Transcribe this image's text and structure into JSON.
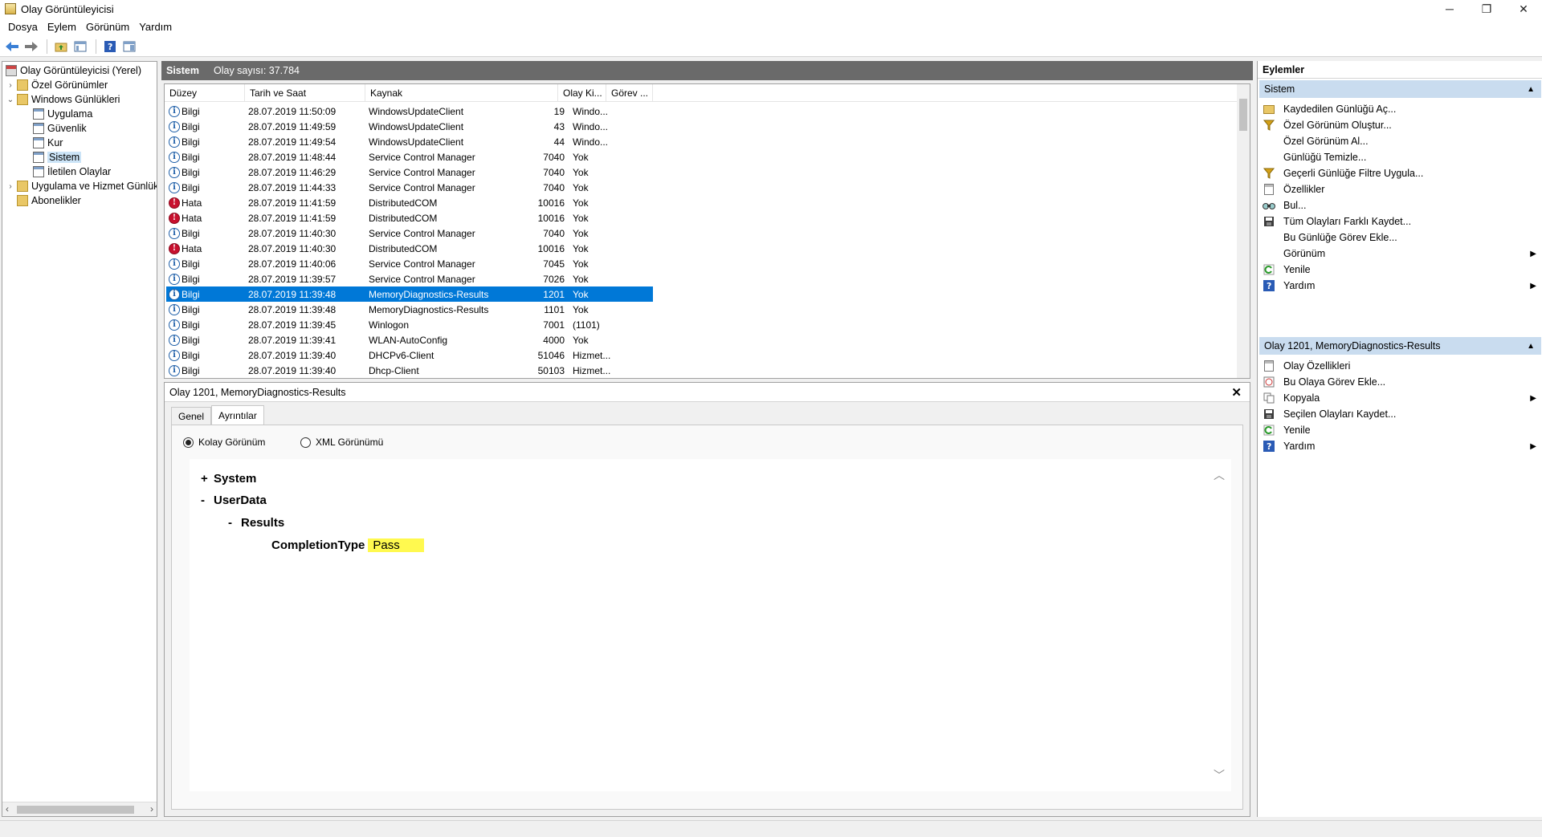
{
  "window": {
    "title": "Olay Görüntüleyicisi",
    "min": "─",
    "max": "❐",
    "close": "✕"
  },
  "menu": [
    "Dosya",
    "Eylem",
    "Görünüm",
    "Yardım"
  ],
  "tree": [
    {
      "label": "Olay Görüntüleyicisi (Yerel)",
      "icon": "event-viewer-icon"
    },
    {
      "label": "Özel Görünümler",
      "icon": "folder-icon"
    },
    {
      "label": "Windows Günlükleri",
      "icon": "folder-icon"
    },
    {
      "label": "Uygulama",
      "icon": "log-icon"
    },
    {
      "label": "Güvenlik",
      "icon": "log-icon"
    },
    {
      "label": "Kur",
      "icon": "log-icon"
    },
    {
      "label": "Sistem",
      "icon": "log-icon"
    },
    {
      "label": "İletilen Olaylar",
      "icon": "log-icon"
    },
    {
      "label": "Uygulama ve Hizmet Günlük",
      "icon": "folder-icon"
    },
    {
      "label": "Abonelikler",
      "icon": "folder-icon"
    }
  ],
  "center": {
    "title": "Sistem",
    "count_label": "Olay sayısı: 37.784",
    "columns": [
      "Düzey",
      "Tarih ve Saat",
      "Kaynak",
      "Olay Ki...",
      "Görev ..."
    ],
    "rows": [
      {
        "level": "Bilgi",
        "date": "28.07.2019 11:50:09",
        "source": "WindowsUpdateClient",
        "id": "19",
        "task": "Windo..."
      },
      {
        "level": "Bilgi",
        "date": "28.07.2019 11:49:59",
        "source": "WindowsUpdateClient",
        "id": "43",
        "task": "Windo..."
      },
      {
        "level": "Bilgi",
        "date": "28.07.2019 11:49:54",
        "source": "WindowsUpdateClient",
        "id": "44",
        "task": "Windo..."
      },
      {
        "level": "Bilgi",
        "date": "28.07.2019 11:48:44",
        "source": "Service Control Manager",
        "id": "7040",
        "task": "Yok"
      },
      {
        "level": "Bilgi",
        "date": "28.07.2019 11:46:29",
        "source": "Service Control Manager",
        "id": "7040",
        "task": "Yok"
      },
      {
        "level": "Bilgi",
        "date": "28.07.2019 11:44:33",
        "source": "Service Control Manager",
        "id": "7040",
        "task": "Yok"
      },
      {
        "level": "Hata",
        "date": "28.07.2019 11:41:59",
        "source": "DistributedCOM",
        "id": "10016",
        "task": "Yok"
      },
      {
        "level": "Hata",
        "date": "28.07.2019 11:41:59",
        "source": "DistributedCOM",
        "id": "10016",
        "task": "Yok"
      },
      {
        "level": "Bilgi",
        "date": "28.07.2019 11:40:30",
        "source": "Service Control Manager",
        "id": "7040",
        "task": "Yok"
      },
      {
        "level": "Hata",
        "date": "28.07.2019 11:40:30",
        "source": "DistributedCOM",
        "id": "10016",
        "task": "Yok"
      },
      {
        "level": "Bilgi",
        "date": "28.07.2019 11:40:06",
        "source": "Service Control Manager",
        "id": "7045",
        "task": "Yok"
      },
      {
        "level": "Bilgi",
        "date": "28.07.2019 11:39:57",
        "source": "Service Control Manager",
        "id": "7026",
        "task": "Yok"
      },
      {
        "level": "Bilgi",
        "date": "28.07.2019 11:39:48",
        "source": "MemoryDiagnostics-Results",
        "id": "1201",
        "task": "Yok"
      },
      {
        "level": "Bilgi",
        "date": "28.07.2019 11:39:48",
        "source": "MemoryDiagnostics-Results",
        "id": "1101",
        "task": "Yok"
      },
      {
        "level": "Bilgi",
        "date": "28.07.2019 11:39:45",
        "source": "Winlogon",
        "id": "7001",
        "task": "(1101)"
      },
      {
        "level": "Bilgi",
        "date": "28.07.2019 11:39:41",
        "source": "WLAN-AutoConfig",
        "id": "4000",
        "task": "Yok"
      },
      {
        "level": "Bilgi",
        "date": "28.07.2019 11:39:40",
        "source": "DHCPv6-Client",
        "id": "51046",
        "task": "Hizmet..."
      },
      {
        "level": "Bilgi",
        "date": "28.07.2019 11:39:40",
        "source": "Dhcp-Client",
        "id": "50103",
        "task": "Hizmet..."
      }
    ]
  },
  "detail": {
    "title": "Olay 1201, MemoryDiagnostics-Results",
    "tabs": [
      "Genel",
      "Ayrıntılar"
    ],
    "radio_friendly": "Kolay Görünüm",
    "radio_xml": "XML Görünümü",
    "xml": {
      "system_sign": "+",
      "system": "System",
      "userdata_sign": "-",
      "userdata": "UserData",
      "results_sign": "-",
      "results": "Results",
      "completion_key": "CompletionType",
      "completion_value": "Pass"
    }
  },
  "actions": {
    "title": "Eylemler",
    "section1": "Sistem",
    "items1": [
      {
        "label": "Kaydedilen Günlüğü Aç...",
        "icon": "open-folder-icon"
      },
      {
        "label": "Özel Görünüm Oluştur...",
        "icon": "filter-icon"
      },
      {
        "label": "Özel Görünüm Al...",
        "icon": ""
      },
      {
        "label": "Günlüğü Temizle...",
        "icon": ""
      },
      {
        "label": "Geçerli Günlüğe Filtre Uygula...",
        "icon": "filter-icon"
      },
      {
        "label": "Özellikler",
        "icon": "properties-icon"
      },
      {
        "label": "Bul...",
        "icon": "find-icon"
      },
      {
        "label": "Tüm Olayları Farklı Kaydet...",
        "icon": "save-icon"
      },
      {
        "label": "Bu Günlüğe Görev Ekle...",
        "icon": ""
      },
      {
        "label": "Görünüm",
        "icon": "",
        "submenu": true
      },
      {
        "label": "Yenile",
        "icon": "refresh-icon"
      },
      {
        "label": "Yardım",
        "icon": "help-icon",
        "submenu": true
      }
    ],
    "section2": "Olay 1201, MemoryDiagnostics-Results",
    "items2": [
      {
        "label": "Olay Özellikleri",
        "icon": "properties-icon"
      },
      {
        "label": "Bu Olaya Görev Ekle...",
        "icon": "task-icon"
      },
      {
        "label": "Kopyala",
        "icon": "copy-icon",
        "submenu": true
      },
      {
        "label": "Seçilen Olayları Kaydet...",
        "icon": "save-icon"
      },
      {
        "label": "Yenile",
        "icon": "refresh-icon"
      },
      {
        "label": "Yardım",
        "icon": "help-icon",
        "submenu": true
      }
    ]
  }
}
